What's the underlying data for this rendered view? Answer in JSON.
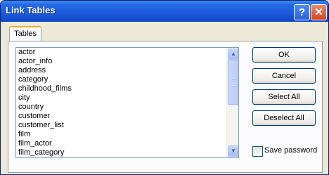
{
  "window": {
    "title": "Link Tables"
  },
  "titlebar_buttons": {
    "help": "?",
    "close": "✕"
  },
  "tab": {
    "label": "Tables"
  },
  "tables": [
    "actor",
    "actor_info",
    "address",
    "category",
    "childhood_films",
    "city",
    "country",
    "customer",
    "customer_list",
    "film",
    "film_actor",
    "film_category"
  ],
  "buttons": {
    "ok": "OK",
    "cancel": "Cancel",
    "select_all": "Select All",
    "deselect_all": "Deselect All"
  },
  "save_password": {
    "label": "Save password",
    "checked": false
  },
  "icons": {
    "scroll_up": "scroll-up-arrow-icon",
    "scroll_down": "scroll-down-arrow-icon"
  }
}
